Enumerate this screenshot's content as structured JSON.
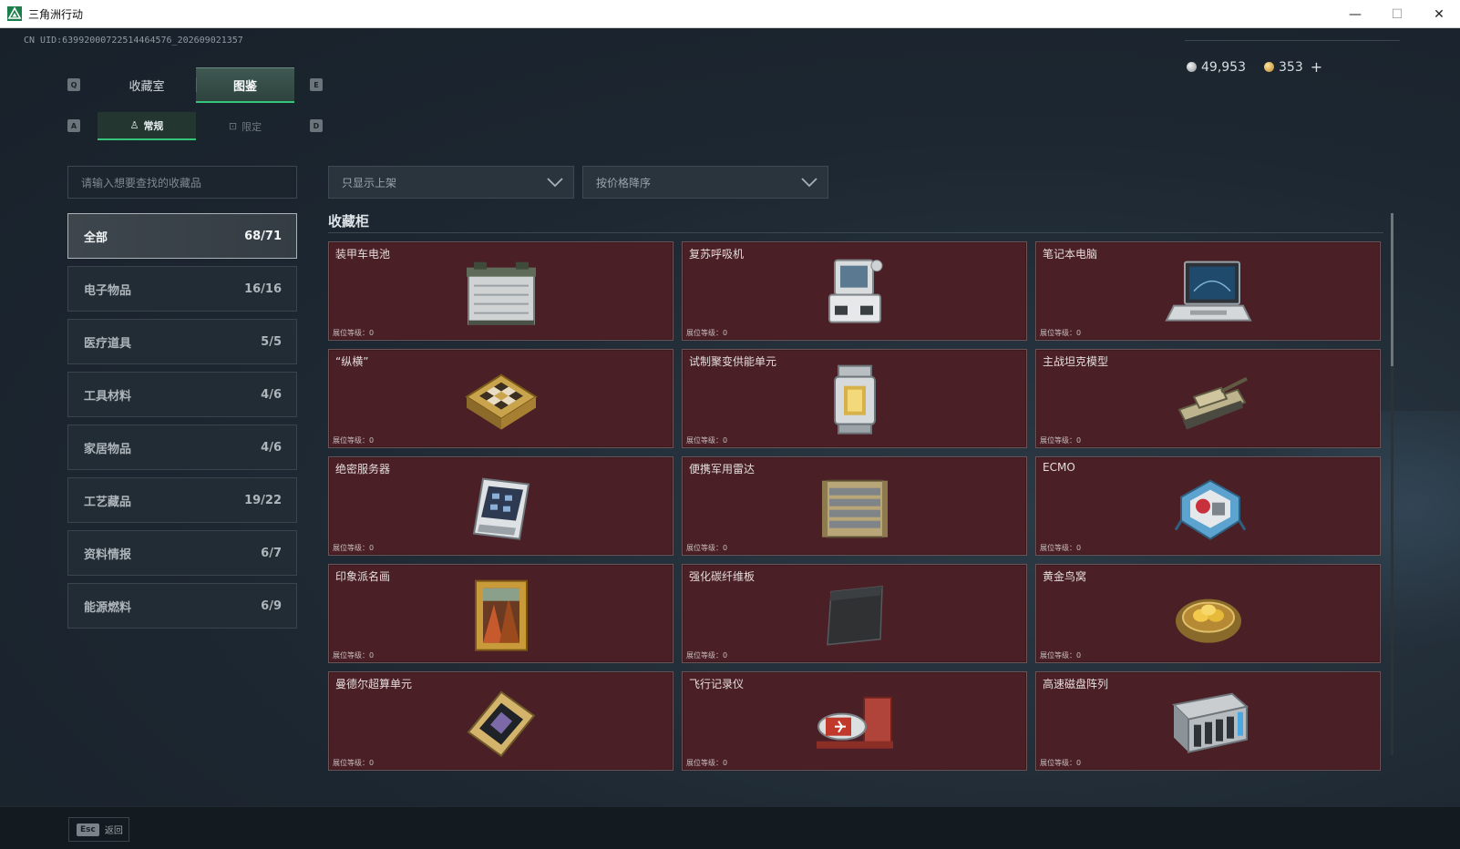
{
  "window": {
    "title": "三角洲行动",
    "controls": [
      "—",
      "☐",
      "✕"
    ]
  },
  "header": {
    "uid": "CN UID:63992000722514464576_202609021357",
    "silver": "49,953",
    "gold": "353",
    "plus": "+"
  },
  "keys": {
    "q": "Q",
    "e": "E",
    "a": "A",
    "d": "D"
  },
  "tabs": [
    {
      "label": "收藏室"
    },
    {
      "label": "图鉴"
    }
  ],
  "subtabs": [
    {
      "label": "常规"
    },
    {
      "label": "限定"
    }
  ],
  "filters": {
    "search_placeholder": "请输入想要查找的收藏品",
    "shelf_filter": "只显示上架",
    "sort": "按价格降序"
  },
  "categories": [
    {
      "label": "全部",
      "count": "68/71"
    },
    {
      "label": "电子物品",
      "count": "16/16"
    },
    {
      "label": "医疗道具",
      "count": "5/5"
    },
    {
      "label": "工具材料",
      "count": "4/6"
    },
    {
      "label": "家居物品",
      "count": "4/6"
    },
    {
      "label": "工艺藏品",
      "count": "19/22"
    },
    {
      "label": "资料情报",
      "count": "6/7"
    },
    {
      "label": "能源燃料",
      "count": "6/9"
    }
  ],
  "section_title": "收藏柜",
  "items": [
    {
      "name": "装甲车电池",
      "level": "展位等级：0",
      "icon": "battery-icon"
    },
    {
      "name": "复苏呼吸机",
      "level": "展位等级：0",
      "icon": "ventilator-icon"
    },
    {
      "name": "笔记本电脑",
      "level": "展位等级：0",
      "icon": "laptop-icon"
    },
    {
      "name": "“纵横”",
      "level": "展位等级：0",
      "icon": "chessboard-icon"
    },
    {
      "name": "试制聚变供能单元",
      "level": "展位等级：0",
      "icon": "fusion-cell-icon"
    },
    {
      "name": "主战坦克模型",
      "level": "展位等级：0",
      "icon": "tank-model-icon"
    },
    {
      "name": "绝密服务器",
      "level": "展位等级：0",
      "icon": "server-icon"
    },
    {
      "name": "便携军用雷达",
      "level": "展位等级：0",
      "icon": "radar-icon"
    },
    {
      "name": "ECMO",
      "level": "展位等级：0",
      "icon": "ecmo-icon"
    },
    {
      "name": "印象派名画",
      "level": "展位等级：0",
      "icon": "painting-icon"
    },
    {
      "name": "强化碳纤维板",
      "level": "展位等级：0",
      "icon": "carbon-plate-icon"
    },
    {
      "name": "黄金鸟窝",
      "level": "展位等级：0",
      "icon": "golden-nest-icon"
    },
    {
      "name": "曼德尔超算单元",
      "level": "展位等级：0",
      "icon": "supercomputer-chip-icon"
    },
    {
      "name": "飞行记录仪",
      "level": "展位等级：0",
      "icon": "flight-recorder-icon"
    },
    {
      "name": "高速磁盘阵列",
      "level": "展位等级：0",
      "icon": "disk-array-icon"
    }
  ],
  "footer": {
    "esc_key": "Esc",
    "esc_label": "返回"
  },
  "colors": {
    "accent": "#35c47a",
    "card_bg": "#4a2026",
    "panel_bg": "#1f2932"
  }
}
